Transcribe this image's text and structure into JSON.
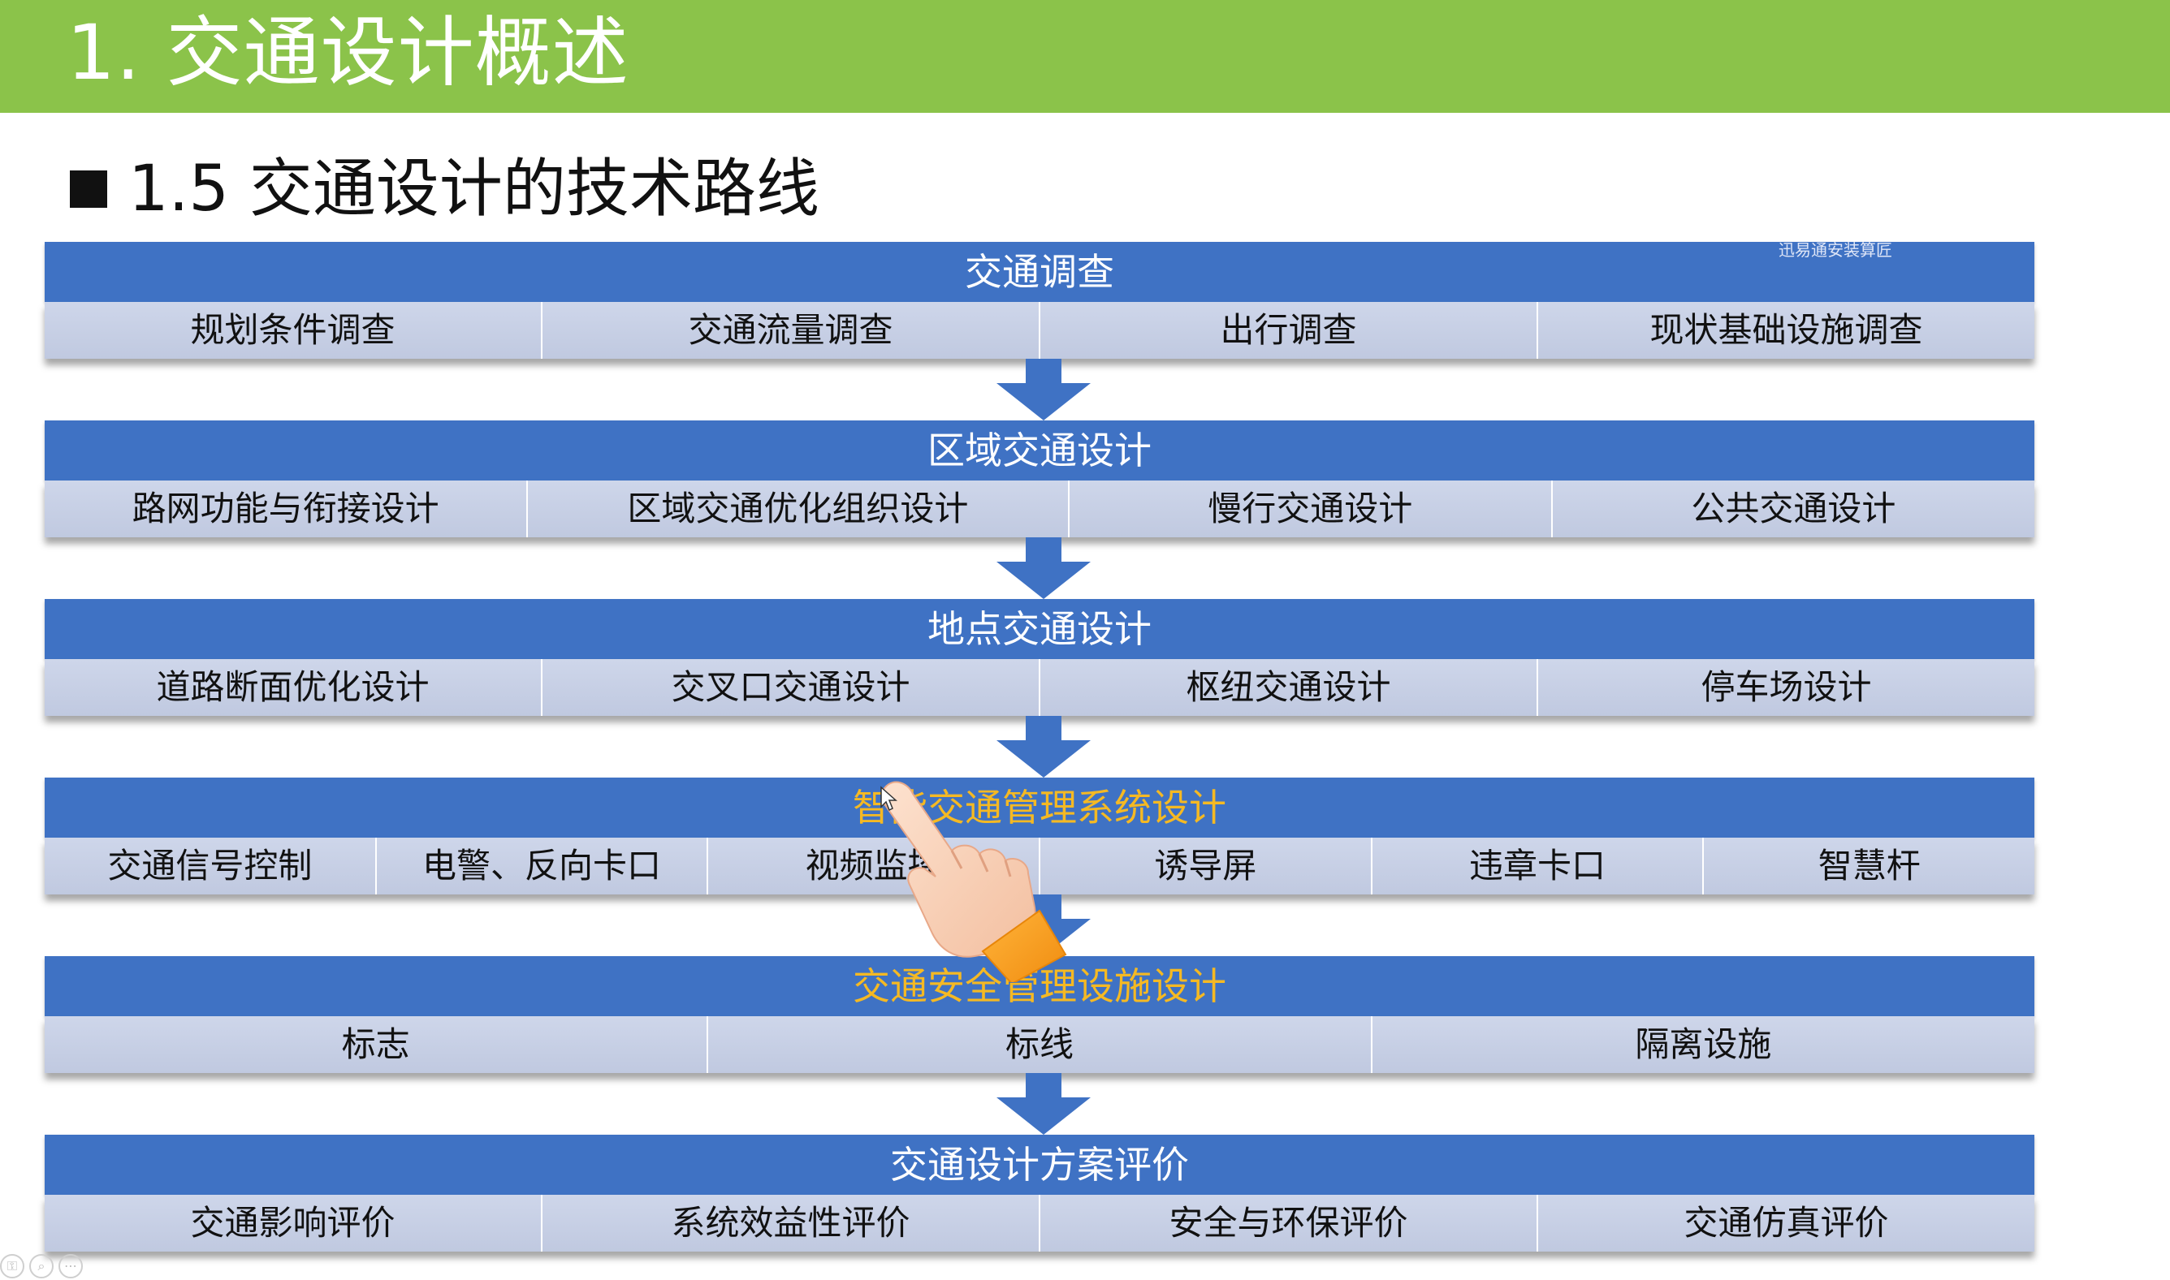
{
  "slide": {
    "title": "1. 交通设计概述",
    "heading": "1.5 交通设计的技术路线",
    "watermark": "迅易通安装算匠"
  },
  "colors": {
    "title_bar": "#8bc34a",
    "header_blue": "#3f72c4",
    "cell_bg": "#c4cde3",
    "accent_text": "#f5b923"
  },
  "blocks": [
    {
      "header": "交通调查",
      "accent": false,
      "items": [
        "规划条件调查",
        "交通流量调查",
        "出行调查",
        "现状基础设施调查"
      ]
    },
    {
      "header": "区域交通设计",
      "accent": false,
      "items": [
        "路网功能与衔接设计",
        "区域交通优化组织设计",
        "慢行交通设计",
        "公共交通设计"
      ]
    },
    {
      "header": "地点交通设计",
      "accent": false,
      "items": [
        "道路断面优化设计",
        "交叉口交通设计",
        "枢纽交通设计",
        "停车场设计"
      ]
    },
    {
      "header": "智能交通管理系统设计",
      "accent": true,
      "items": [
        "交通信号控制",
        "电警、反向卡口",
        "视频监控",
        "诱导屏",
        "违章卡口",
        "智慧杆"
      ]
    },
    {
      "header": "交通安全管理设施设计",
      "accent": true,
      "items": [
        "标志",
        "标线",
        "隔离设施"
      ]
    },
    {
      "header": "交通设计方案评价",
      "accent": false,
      "items": [
        "交通影响评价",
        "系统效益性评价",
        "安全与环保评价",
        "交通仿真评价"
      ]
    }
  ],
  "icons": {
    "arrow": "down-arrow-icon",
    "pointer": "pointing-hand-icon",
    "cursor": "mouse-cursor-icon"
  }
}
